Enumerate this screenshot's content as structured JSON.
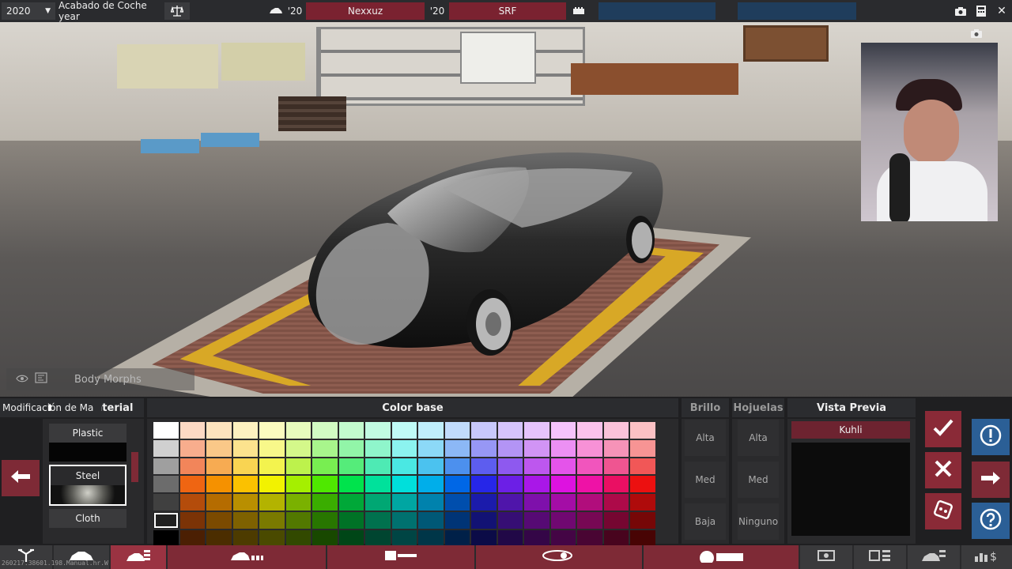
{
  "topbar": {
    "year": "2020",
    "title": "Acabado de Coche year",
    "car_year": "'20",
    "car_name": "Nexxuz",
    "engine_year": "'20",
    "engine_name": "SRF"
  },
  "scene": {
    "body_morphs_label": "Body Morphs"
  },
  "material": {
    "header": "Material",
    "tab_label": "Modificación de Ma",
    "items": [
      {
        "label": "Plastic",
        "selected": false
      },
      {
        "label": "Steel",
        "selected": true
      },
      {
        "label": "Cloth",
        "selected": false
      }
    ]
  },
  "color": {
    "header": "Color base",
    "selected_row": 5,
    "selected_col": 0,
    "colors": [
      [
        "#ffffff",
        "#fcd9c4",
        "#fde3be",
        "#fdf1c0",
        "#fbfbbf",
        "#e8fbbd",
        "#d2fbc3",
        "#c3fbce",
        "#c2fbe2",
        "#c0fbf6",
        "#c0eefb",
        "#c1dbfb",
        "#c8c8fb",
        "#d6c4fb",
        "#e6c3fb",
        "#f5c3fb",
        "#fbc2ec",
        "#fbc2da",
        "#fbc1c4"
      ],
      [
        "#d0d0d0",
        "#f8ad8d",
        "#fac888",
        "#fce38e",
        "#f8f88a",
        "#d4f88a",
        "#a8f58c",
        "#92f5a8",
        "#8ff5cb",
        "#8cf3ef",
        "#8cd9f7",
        "#8cb8f6",
        "#9797f5",
        "#b394f5",
        "#d194f5",
        "#ec90f3",
        "#f791d6",
        "#f693b8",
        "#f79494"
      ],
      [
        "#9f9f9f",
        "#f2855a",
        "#f7ab52",
        "#f9d452",
        "#f3f34e",
        "#bdf24c",
        "#78ee51",
        "#55ec7a",
        "#4eeab4",
        "#4ae8e3",
        "#4bc2ef",
        "#4c90ee",
        "#5d5def",
        "#8e59ef",
        "#bd57ee",
        "#e454ea",
        "#f155bd",
        "#ef5591",
        "#f15757"
      ],
      [
        "#6c6c6c",
        "#ef6512",
        "#f59100",
        "#fbc100",
        "#f2f200",
        "#a5ef00",
        "#4fe800",
        "#00e34c",
        "#00e19b",
        "#00dfdb",
        "#00aeea",
        "#0067e6",
        "#2626e8",
        "#6c1fe6",
        "#a917e8",
        "#dd12e0",
        "#ee12a6",
        "#ea0f63",
        "#ec1010"
      ],
      [
        "#404040",
        "#b44c0b",
        "#b56c00",
        "#b98f00",
        "#b3b300",
        "#7ab100",
        "#3aad00",
        "#00a838",
        "#00a773",
        "#00a6a2",
        "#0082ad",
        "#004ead",
        "#1b1bab",
        "#4f15aa",
        "#7e10ab",
        "#a40da6",
        "#b10d7c",
        "#ad0a49",
        "#af0b0b"
      ],
      [
        "#202020",
        "#7b3306",
        "#7b4a00",
        "#7e6100",
        "#7a7a00",
        "#527800",
        "#287600",
        "#007226",
        "#00714e",
        "#00716f",
        "#005876",
        "#003476",
        "#121274",
        "#360e74",
        "#560a74",
        "#700871",
        "#770854",
        "#750631",
        "#760707"
      ],
      [
        "#000000",
        "#4b1f03",
        "#4b2d00",
        "#4d3b00",
        "#4a4a00",
        "#324900",
        "#184800",
        "#004617",
        "#004530",
        "#004544",
        "#003648",
        "#002048",
        "#0b0b47",
        "#210847",
        "#340647",
        "#440545",
        "#490533",
        "#48041e",
        "#480404"
      ]
    ]
  },
  "brillo": {
    "header": "Brillo",
    "levels": [
      "Alta",
      "Med",
      "Baja"
    ]
  },
  "hojuelas": {
    "header": "Hojuelas",
    "levels": [
      "Alta",
      "Med",
      "Ninguno"
    ]
  },
  "preview": {
    "header": "Vista Previa",
    "name": "Kuhli"
  },
  "debug_text": "260217.38601.198.Manual.hr.W",
  "accent_colors": {
    "red": "#7e2a36",
    "blue": "#1f3d5c"
  }
}
